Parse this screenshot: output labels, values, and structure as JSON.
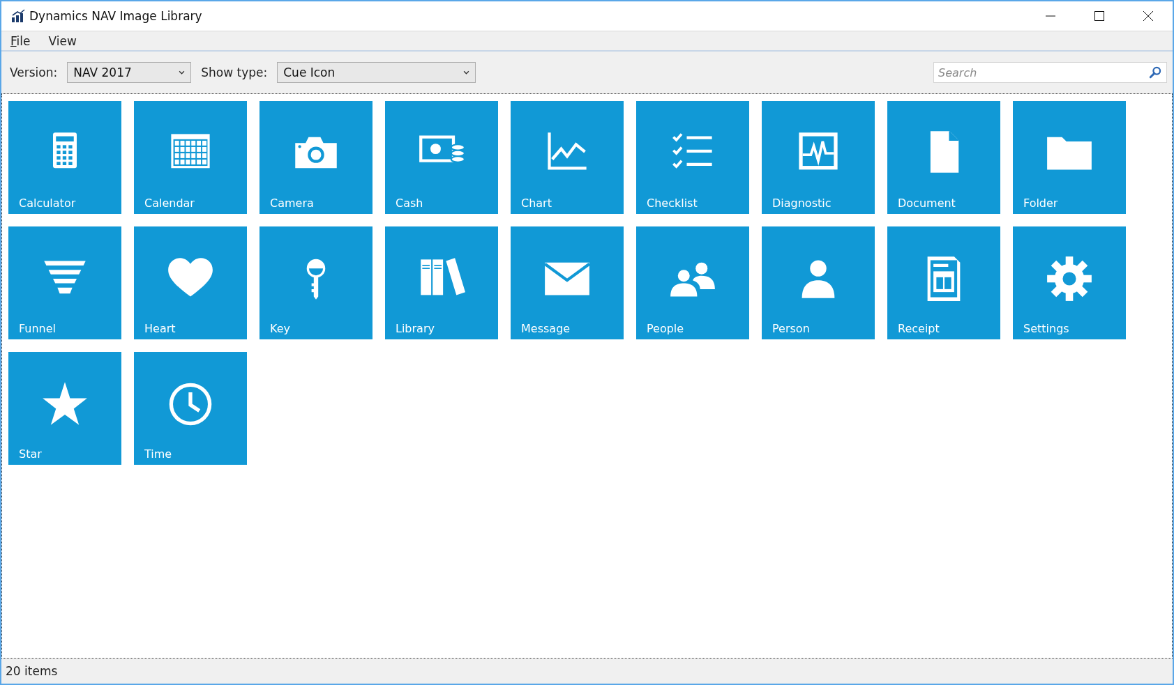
{
  "window": {
    "title": "Dynamics NAV Image Library"
  },
  "menu": [
    {
      "label": "File",
      "mnemonic_underlined": true
    },
    {
      "label": "View",
      "mnemonic_underlined": false
    }
  ],
  "toolbar": {
    "version_label": "Version:",
    "version_value": "NAV 2017",
    "type_label": "Show type:",
    "type_value": "Cue Icon",
    "search": {
      "placeholder": "Search"
    }
  },
  "tiles": [
    {
      "label": "Calculator",
      "kind": "calculator"
    },
    {
      "label": "Calendar",
      "kind": "calendar"
    },
    {
      "label": "Camera",
      "kind": "camera"
    },
    {
      "label": "Cash",
      "kind": "cash"
    },
    {
      "label": "Chart",
      "kind": "chart"
    },
    {
      "label": "Checklist",
      "kind": "checklist"
    },
    {
      "label": "Diagnostic",
      "kind": "diagnostic"
    },
    {
      "label": "Document",
      "kind": "document"
    },
    {
      "label": "Folder",
      "kind": "folder"
    },
    {
      "label": "Funnel",
      "kind": "funnel"
    },
    {
      "label": "Heart",
      "kind": "heart"
    },
    {
      "label": "Key",
      "kind": "key"
    },
    {
      "label": "Library",
      "kind": "library"
    },
    {
      "label": "Message",
      "kind": "message"
    },
    {
      "label": "People",
      "kind": "people"
    },
    {
      "label": "Person",
      "kind": "person"
    },
    {
      "label": "Receipt",
      "kind": "receipt"
    },
    {
      "label": "Settings",
      "kind": "settings"
    },
    {
      "label": "Star",
      "kind": "star"
    },
    {
      "label": "Time",
      "kind": "time"
    }
  ],
  "status_bar": {
    "text": "20 items"
  }
}
